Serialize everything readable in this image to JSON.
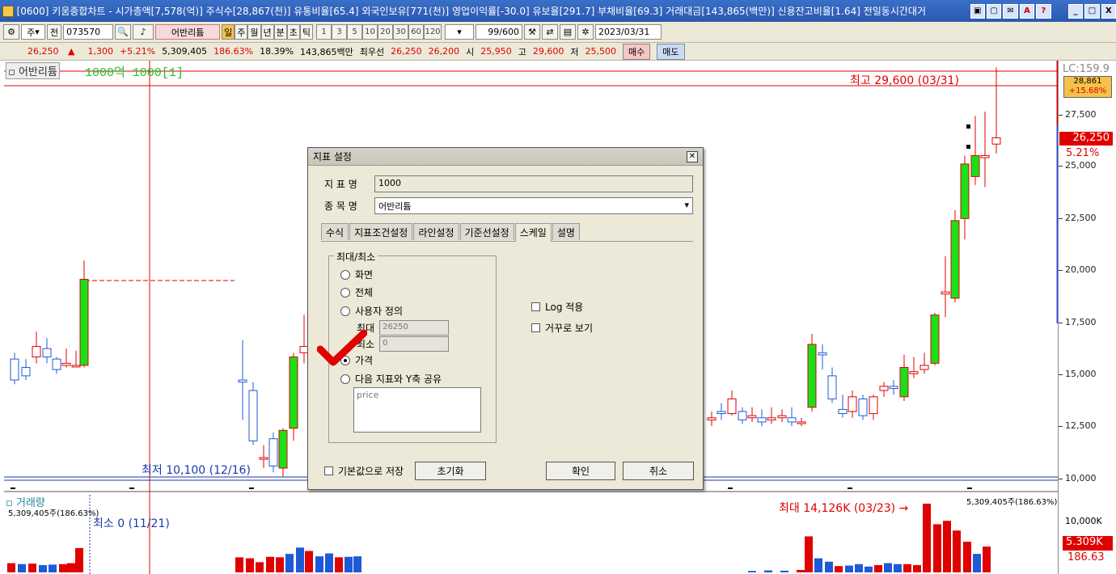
{
  "titlebar": {
    "text": "[0600] 키움종합차트 - 시가총액[7,578(억)] 주식수[28,867(천)] 유통비율[65.4] 외국인보유[771(천)] 영업이익률[-30.0] 유보율[291.7] 부채비율[69.3] 거래대금[143,865(백만)] 신용잔고비율[1.64] 전일동시간대거",
    "buttons": [
      "▣",
      "▢",
      "✉",
      "A",
      "?"
    ],
    "window_controls": [
      "_",
      "□",
      "X"
    ]
  },
  "toolbar": {
    "period_select": "주",
    "jeon": "전",
    "code": "073570",
    "stock_name": "어반리튬",
    "period_buttons": [
      "일",
      "주",
      "월",
      "년",
      "분",
      "초",
      "틱"
    ],
    "active_period": "일",
    "minute_buttons": [
      "1",
      "3",
      "5",
      "10",
      "20",
      "30",
      "60",
      "120"
    ],
    "count": "99/600",
    "date": "2023/03/31"
  },
  "quote": {
    "price": "26,250",
    "arrow": "▲",
    "change": "1,300",
    "change_pct": "+5.21%",
    "volume": "5,309,405",
    "vol_ratio": "186.63%",
    "turnover": "18.39%",
    "amount": "143,865백만",
    "best_label": "최우선",
    "best_ask": "26,250",
    "best_bid": "26,200",
    "open_label": "시",
    "open": "25,950",
    "high_label": "고",
    "high": "29,600",
    "low_label": "저",
    "low": "25,500",
    "buy_label": "매수",
    "sell_label": "매도"
  },
  "chart": {
    "stock_label": "어반리튬",
    "indicator_label": "1000억 1000[1]",
    "max_label": "최고 29,600 (03/31)",
    "min_label": "최저 10,100 (12/16)",
    "volume_label": "거래량",
    "volume_value": "5,309,405주(186.63%)",
    "volume_value_right": "5,309,405주(186.63%)",
    "vol_min_label": "최소 0 (11/21)",
    "vol_max_label": "최대 14,126K (03/23) →",
    "lc_label": "LC:159.9",
    "cur_price": "28,861",
    "cur_pct": "+15.68%",
    "price_tag": "26,250",
    "pct_tag": "5.21%",
    "vol_tag": "5.309K",
    "vol_pct_tag": "186.63",
    "vol_tick": "10,000K",
    "yticks": [
      "27,500",
      "25,000",
      "22,500",
      "20,000",
      "17,500",
      "15,000",
      "12,500",
      "10,000"
    ],
    "colors": {
      "up": "#e00000",
      "down": "#1e5ad8",
      "bull": "#19e019",
      "accent": "#f4c24a"
    }
  },
  "dialog": {
    "title": "지표 설정",
    "name_label": "지 표 명",
    "name_value": "1000",
    "stock_label": "종 목 명",
    "stock_value": "어반리튬",
    "tabs": [
      "수식",
      "지표조건설정",
      "라인설정",
      "기준선설정",
      "스케일",
      "설명"
    ],
    "active_tab": "스케일",
    "group_title": "최대/최소",
    "radios": [
      "화면",
      "전체",
      "사용자 정의",
      "가격",
      "다음 지표와 Y축 공유"
    ],
    "selected_radio": "가격",
    "max_label": "최대",
    "max_value": "26250",
    "min_label": "최소",
    "min_value": "0",
    "share_value": "price",
    "log_label": "Log 적용",
    "invert_label": "거꾸로 보기",
    "save_default_label": "기본값으로 저장",
    "reset_label": "초기화",
    "ok_label": "확인",
    "cancel_label": "취소"
  }
}
